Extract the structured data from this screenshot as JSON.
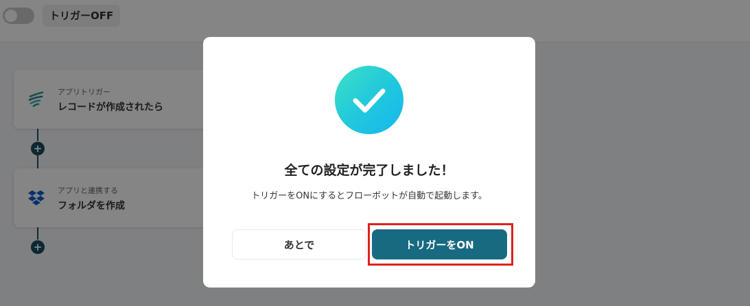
{
  "topbar": {
    "toggle_state": "off",
    "trigger_status_label": "トリガーOFF"
  },
  "flow": {
    "steps": [
      {
        "sub": "アプリトリガー",
        "title": "レコードが作成されたら",
        "icon": "app-trigger-logo-icon"
      },
      {
        "sub": "アプリと連携する",
        "title": "フォルダを作成",
        "icon": "dropbox-icon"
      }
    ],
    "add_step_symbol": "+"
  },
  "modal": {
    "title": "全ての設定が完了しました！",
    "description": "トリガーをONにするとフローボットが自動で起動します。",
    "later_label": "あとで",
    "on_label": "トリガーをON",
    "icon": "check-icon"
  },
  "colors": {
    "primary": "#176a80",
    "connector": "#1a4e63",
    "highlight": "#e0201c",
    "check_gradient_start": "#3ee0c5",
    "check_gradient_end": "#16b6ee"
  }
}
